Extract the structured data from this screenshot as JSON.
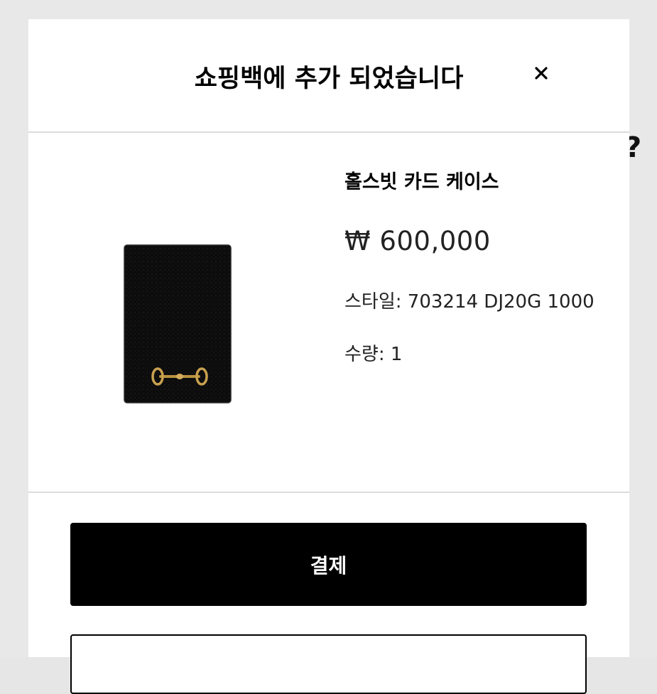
{
  "modal": {
    "title": "쇼핑백에 추가 되었습니다",
    "close_icon": "close-icon"
  },
  "product": {
    "name": "홀스빗 카드 케이스",
    "price": "₩ 600,000",
    "style": "스타일: 703214 DJ20G 1000",
    "quantity": "수량: 1",
    "image_icon": "card-case-image"
  },
  "actions": {
    "checkout_label": "결제",
    "secondary_label": ""
  },
  "background": {
    "partial_glyph": "?"
  },
  "colors": {
    "button_bg": "#000000",
    "button_text": "#ffffff",
    "divider": "#dcdcdc",
    "backdrop": "#e8e8e8"
  }
}
